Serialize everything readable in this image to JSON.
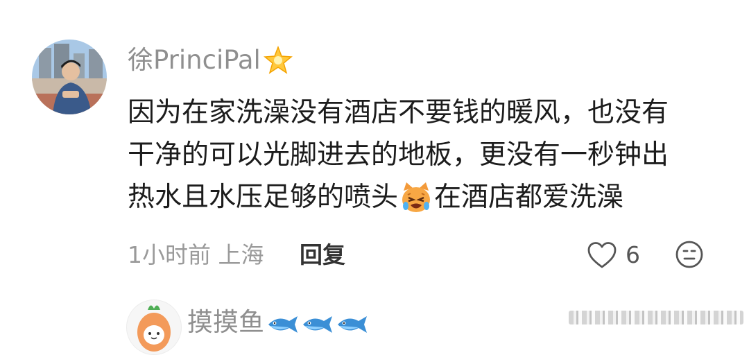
{
  "comment": {
    "username": "徐PrinciPal",
    "username_badge_icon": "star-emoji-icon",
    "lines": [
      "因为在家洗澡没有酒店不要钱的暖风，也没有",
      "干净的可以光脚进去的地板，更没有一秒钟出",
      "热水且水压足够的喷头"
    ],
    "emoji_icon": "crying-cat-emoji-icon",
    "line3_after_emoji": "在酒店都爱洗澡",
    "meta": "1小时前 上海",
    "reply_label": "回复",
    "like_count": "6"
  },
  "next_comment": {
    "username": "摸摸鱼",
    "badge_icons": [
      "fish-emoji-icon",
      "fish-emoji-icon",
      "fish-emoji-icon"
    ]
  },
  "colors": {
    "username": "#8f8f8f",
    "text": "#1c1c1c",
    "meta": "#9a9a9a",
    "reply": "#333333"
  }
}
